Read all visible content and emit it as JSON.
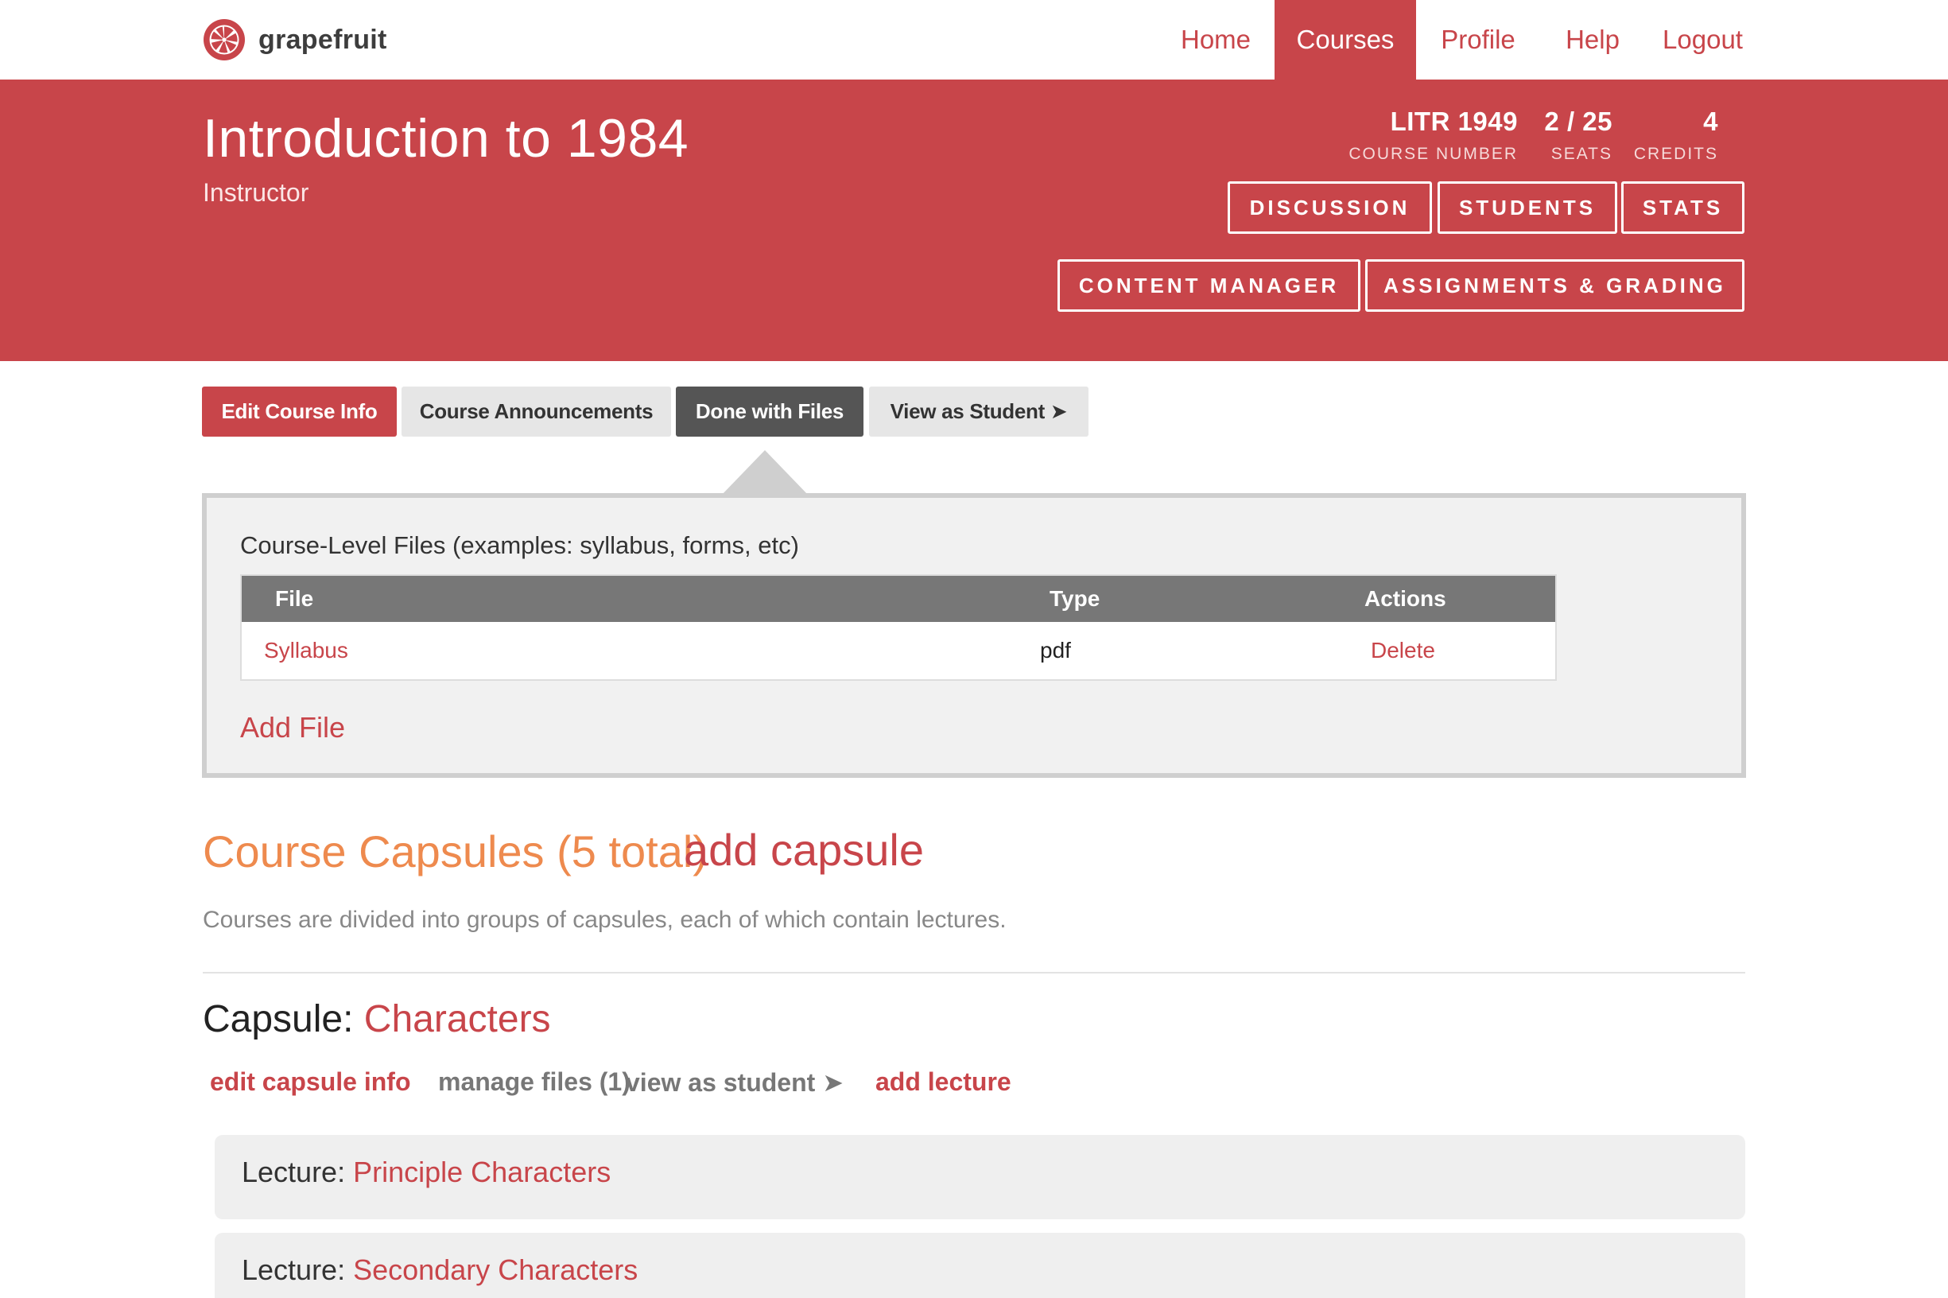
{
  "brand": {
    "name": "grapefruit",
    "logo_icon": "grapefruit-logo-icon"
  },
  "nav": {
    "items": [
      {
        "label": "Home",
        "active": false
      },
      {
        "label": "Courses",
        "active": true
      },
      {
        "label": "Profile",
        "active": false
      },
      {
        "label": "Help",
        "active": false
      },
      {
        "label": "Logout",
        "active": false
      }
    ]
  },
  "course": {
    "title": "Introduction to 1984",
    "role": "Instructor",
    "stats": [
      {
        "value": "LITR 1949",
        "label": "COURSE NUMBER"
      },
      {
        "value": "2 / 25",
        "label": "SEATS"
      },
      {
        "value": "4",
        "label": "CREDITS"
      }
    ],
    "buttons_row1": [
      "DISCUSSION",
      "STUDENTS",
      "STATS"
    ],
    "buttons_row2": [
      "CONTENT MANAGER",
      "ASSIGNMENTS & GRADING"
    ]
  },
  "tabs": [
    {
      "label": "Edit Course Info",
      "style": "red"
    },
    {
      "label": "Course Announcements",
      "style": "grey"
    },
    {
      "label": "Done with Files",
      "style": "dark"
    },
    {
      "label": "View as Student ➤",
      "style": "grey"
    }
  ],
  "files": {
    "title": "Course-Level Files (examples: syllabus, forms, etc)",
    "columns": [
      "File",
      "Type",
      "Actions"
    ],
    "rows": [
      {
        "file": "Syllabus",
        "type": "pdf",
        "action": "Delete"
      }
    ],
    "add_label": "Add File"
  },
  "capsules": {
    "heading": "Course Capsules (5 total)",
    "add_label": "add capsule",
    "description": "Courses are divided into groups of capsules, each of which contain lectures.",
    "current": {
      "prefix": "Capsule:",
      "name": "Characters",
      "actions": {
        "edit": "edit capsule info",
        "manage": "manage files (1)",
        "view": "view as student ➤",
        "add_lecture": "add lecture"
      },
      "lectures": [
        {
          "prefix": "Lecture:",
          "name": "Principle Characters"
        },
        {
          "prefix": "Lecture:",
          "name": "Secondary Characters"
        }
      ]
    }
  },
  "colors": {
    "brand_red": "#c8454a",
    "capsule_orange": "#ee8a4e",
    "table_header": "#777777",
    "dark_tab": "#555555"
  }
}
